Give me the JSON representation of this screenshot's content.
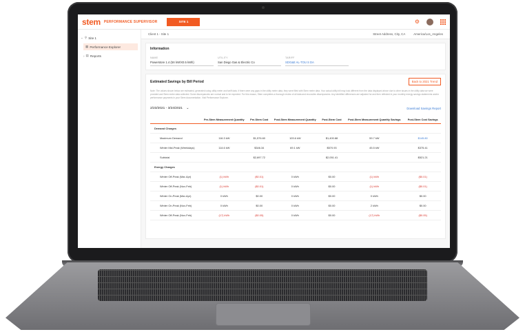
{
  "app": {
    "logo": "stem",
    "title": "PERFORMANCE SUPERVISOR",
    "site_button": "SITE 1"
  },
  "sidebar": {
    "site": "Site 1",
    "items": [
      {
        "label": "Performance Explorer",
        "active": true
      },
      {
        "label": "Reports",
        "active": false
      }
    ]
  },
  "context": {
    "breadcrumb": "Client 1 - Site 1",
    "address": "Street Address, City, CA",
    "timezone": "America/Los_Angeles"
  },
  "information": {
    "title": "Information",
    "fields": [
      {
        "label": "NAME",
        "value": "Powerstore 1.4 (5X kW/X0.5 kWh)"
      },
      {
        "label": "UTILITY",
        "value": "San Diego Gas & Electric Co"
      },
      {
        "label": "TARIFF",
        "value": "SDG&E AL-TOU S DA"
      }
    ]
  },
  "savings": {
    "title": "Estimated Savings by Bill Period",
    "back_button": "Back to 2021 Trend",
    "note": "Note: The values shown below are estimated, generated using utility meter and tariff data. If there were any gaps in the utility meter data, they were filled with Stem meter data. Your actual utility bill may look different from the data displayed above due to other issues in the utility data we were provided and Stem meter data collected. Some discrepancies are normal and to be expected. For this reason, Stem completes a thorough review of all data and reconciles discrepancies. Any identified differences are adjusted for and then reflected in your monthly energy savings statements and/or performance payments in your Stem documentation. Visit Performance Explorer.",
    "period": "2/23/2021 - 3/24/2021",
    "download_link": "Download Savings Report",
    "columns": [
      "",
      "Pre-Stem Measurement Quantity",
      "Pre-Stem Cost",
      "Post-Stem Measurement Quantity",
      "Post-Stem Cost",
      "Post-Stem Measurement Quantity Savings",
      "Post-Stem Cost Savings"
    ],
    "rows": [
      {
        "group": "Demand Charges"
      },
      {
        "cells": [
          "Maximum Demand",
          "116.3 kW",
          "$1,576.60",
          "103.6 kW",
          "$1,400.88",
          "59.7 kW",
          "$145.80"
        ],
        "neg": [],
        "pos": [
          6
        ]
      },
      {
        "cells": [
          "Winter Mid-Peak (Weekdays)",
          "114.6 kW",
          "$346.34",
          "69.1 kW",
          "$570.93",
          "45.5 kW",
          "$375.41"
        ],
        "neg": [],
        "pos": []
      },
      {
        "cells": [
          "Subtotal",
          "",
          "$2,697.72",
          "",
          "$2,051.41",
          "",
          "$521.21"
        ],
        "neg": [],
        "pos": []
      },
      {
        "group": "Energy Charges"
      },
      {
        "cells": [
          "Winter Off-Peak (Mar-Apr)",
          "(1) kWh",
          "($0.01)",
          "0 kWh",
          "$0.00",
          "(1) kWh",
          "($0.01)"
        ],
        "neg": [
          1,
          2,
          5,
          6
        ],
        "pos": []
      },
      {
        "cells": [
          "Winter Off-Peak (Nov-Feb)",
          "(1) kWh",
          "($0.01)",
          "0 kWh",
          "$0.00",
          "(1) kWh",
          "($0.01)"
        ],
        "neg": [
          1,
          2,
          5,
          6
        ],
        "pos": []
      },
      {
        "cells": [
          "Winter On-Peak (Mar-Apr)",
          "0 kWh",
          "$0.00",
          "0 kWh",
          "$0.00",
          "0 kWh",
          "$0.00"
        ],
        "neg": [],
        "pos": []
      },
      {
        "cells": [
          "Winter On-Peak (Nov-Feb)",
          "0 kWh",
          "$0.00",
          "0 kWh",
          "$0.00",
          "2 kWh",
          "$0.00"
        ],
        "neg": [],
        "pos": []
      },
      {
        "cells": [
          "Winter Off-Peak (Nov-Feb)",
          "(17) kWh",
          "($0.05)",
          "0 kWh",
          "$0.00",
          "(17) kWh",
          "($0.05)"
        ],
        "neg": [
          1,
          2,
          5,
          6
        ],
        "pos": []
      }
    ]
  }
}
